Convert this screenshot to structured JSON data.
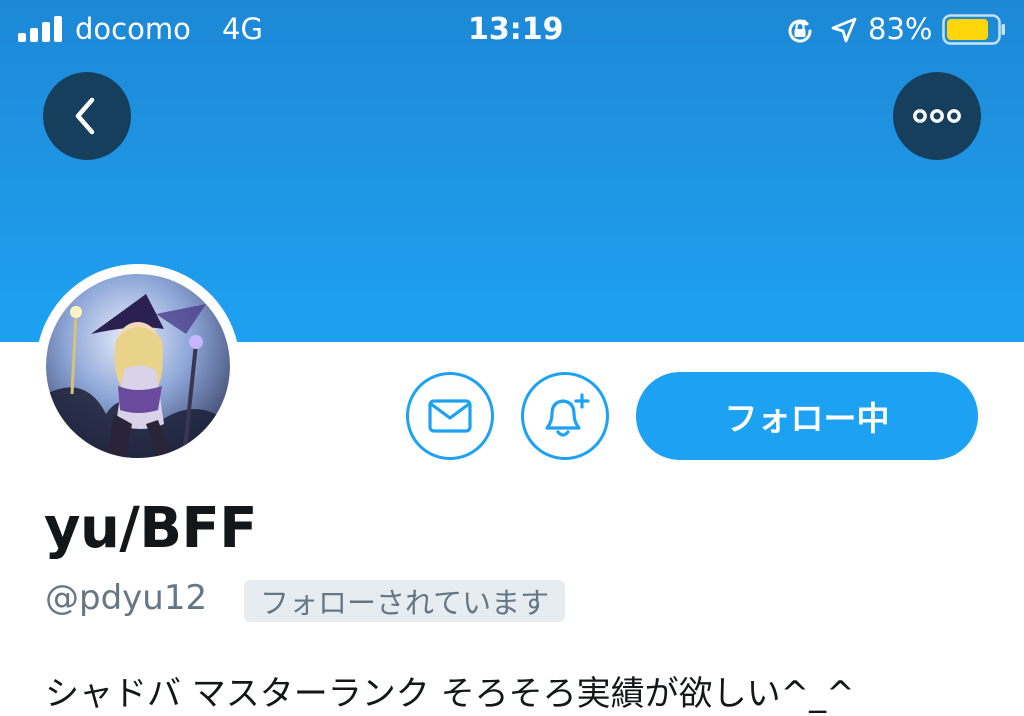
{
  "status_bar": {
    "carrier": "docomo",
    "network": "4G",
    "time": "13:19",
    "battery_percent": "83%",
    "battery_level": 0.83,
    "battery_color": "#ffd60a",
    "icons": [
      "signal-icon",
      "rotation-lock-icon",
      "location-icon",
      "battery-icon"
    ]
  },
  "header": {
    "banner_color": "#1da1f2",
    "back_icon": "chevron-left-icon",
    "more_icon": "ellipsis-icon"
  },
  "profile": {
    "display_name": "yu/BFF",
    "username": "@pdyu12",
    "follows_you_badge": "フォローされています",
    "bio": "シャドバ マスターランク そろそろ実績が欲しい^_^"
  },
  "actions": {
    "message_icon": "envelope-icon",
    "notify_icon": "bell-plus-icon",
    "following_label": "フォロー中",
    "accent_color": "#1da1f2"
  }
}
